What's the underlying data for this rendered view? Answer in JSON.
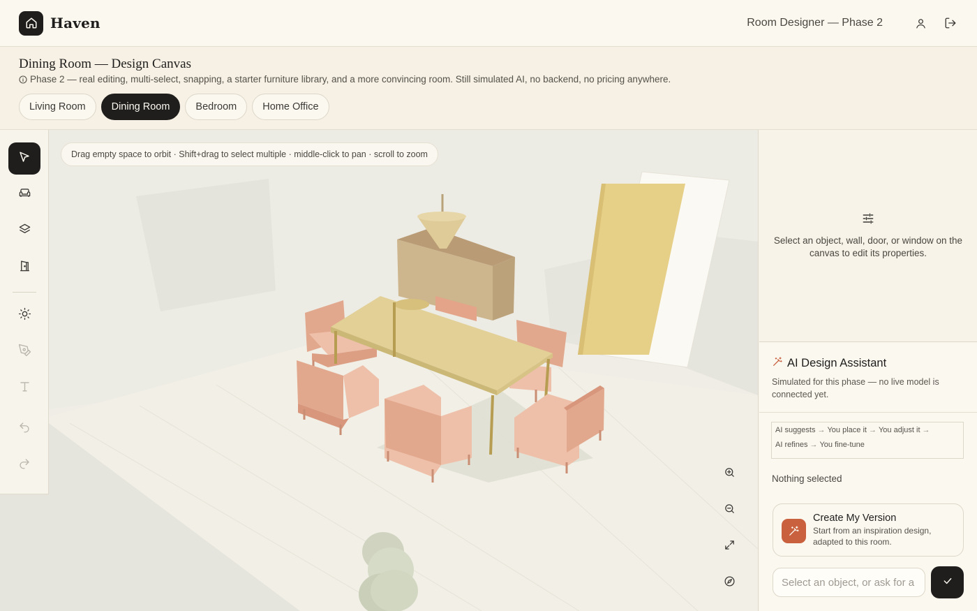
{
  "app": {
    "brand": "Haven",
    "phase_label": "Room Designer — Phase 2"
  },
  "page": {
    "title": "Dining Room — Design Canvas",
    "subtitle": "Phase 2 — real editing, multi-select, snapping, a starter furniture library, and a more convincing room. Still simulated AI, no backend, no pricing anywhere."
  },
  "tabs": [
    {
      "label": "Living Room",
      "active": false
    },
    {
      "label": "Dining Room",
      "active": true
    },
    {
      "label": "Bedroom",
      "active": false
    },
    {
      "label": "Home Office",
      "active": false
    }
  ],
  "canvas": {
    "hint": "Drag empty space to orbit · Shift+drag to select multiple · middle-click to pan · scroll to zoom"
  },
  "tools": [
    {
      "name": "select-tool",
      "icon": "cursor-icon",
      "active": true,
      "enabled": true
    },
    {
      "name": "furniture-tool",
      "icon": "sofa-icon",
      "active": false,
      "enabled": true
    },
    {
      "name": "layers-tool",
      "icon": "layers-icon",
      "active": false,
      "enabled": true
    },
    {
      "name": "door-tool",
      "icon": "door-icon",
      "active": false,
      "enabled": true
    },
    {
      "name": "lighting-tool",
      "icon": "sun-icon",
      "active": false,
      "enabled": true
    },
    {
      "name": "paint-tool",
      "icon": "brush-icon",
      "active": false,
      "enabled": false
    },
    {
      "name": "text-tool",
      "icon": "text-icon",
      "active": false,
      "enabled": false
    },
    {
      "name": "undo-tool",
      "icon": "undo-icon",
      "active": false,
      "enabled": false
    },
    {
      "name": "redo-tool",
      "icon": "redo-icon",
      "active": false,
      "enabled": false
    }
  ],
  "view_controls": [
    "zoom-in-icon",
    "zoom-out-icon",
    "fit-view-icon",
    "compass-icon"
  ],
  "properties": {
    "empty_message": "Select an object, wall, door, or window on the canvas to edit its properties."
  },
  "assistant": {
    "title": "AI Design Assistant",
    "description": "Simulated for this phase — no live model is connected yet.",
    "flow": [
      "AI suggests",
      "You place it",
      "You adjust it",
      "AI refines",
      "You fine-tune"
    ],
    "selection_status": "Nothing selected",
    "create_card": {
      "title": "Create My Version",
      "subtitle": "Start from an inspiration design, adapted to this room."
    },
    "input_placeholder": "Select an object, or ask for a"
  },
  "colors": {
    "accent_dark": "#1f1e1c",
    "create_accent": "#c9603e",
    "background": "#fbf8f0",
    "chair": "#e8b39a",
    "table": "#e2d096",
    "sideboard": "#c9b08a",
    "panel_yellow": "#e6cf86"
  }
}
